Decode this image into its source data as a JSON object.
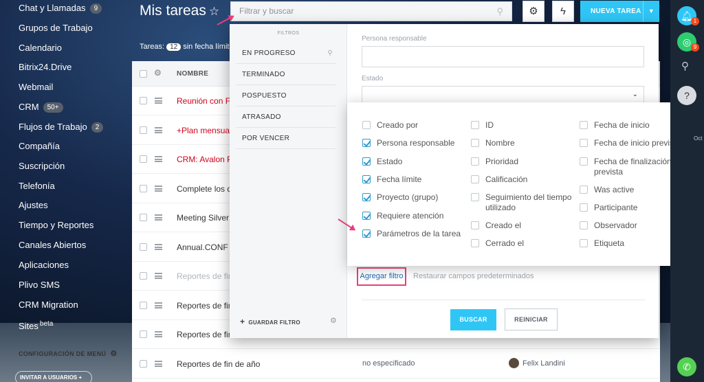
{
  "sidebar": {
    "items": [
      {
        "label": "Chat y Llamadas",
        "badge": "9"
      },
      {
        "label": "Grupos de Trabajo"
      },
      {
        "label": "Calendario"
      },
      {
        "label": "Bitrix24.Drive"
      },
      {
        "label": "Webmail"
      },
      {
        "label": "CRM",
        "badge": "50+"
      },
      {
        "label": "Flujos de Trabajo",
        "badge": "2"
      },
      {
        "label": "Compañía"
      },
      {
        "label": "Suscripción"
      },
      {
        "label": "Telefonía"
      },
      {
        "label": "Ajustes"
      },
      {
        "label": "Tiempo y Reportes"
      },
      {
        "label": "Canales Abiertos"
      },
      {
        "label": "Aplicaciones"
      },
      {
        "label": "Plivo SMS"
      },
      {
        "label": "CRM Migration"
      },
      {
        "label": "Sites",
        "sup": "beta"
      }
    ],
    "config_label": "CONFIGURACIÓN DE MENÚ",
    "invite_label": "INVITAR A USUARIOS"
  },
  "header": {
    "title": "Mis tareas",
    "search_placeholder": "Filtrar y buscar",
    "new_task_label": "NUEVA TAREA",
    "tasks_label": "Tareas:",
    "tasks_count": "12",
    "tasks_suffix": "sin fecha límit"
  },
  "table": {
    "column_name": "NOMBRE",
    "rows": [
      {
        "name": "Reunión con Fe",
        "color": "#d0021b"
      },
      {
        "name": "+Plan mensual",
        "color": "#d0021b"
      },
      {
        "name": "CRM: Avalon P",
        "color": "#d0021b"
      },
      {
        "name": "Complete los d",
        "color": "#333333"
      },
      {
        "name": "Meeting Silver F",
        "color": "#333333"
      },
      {
        "name": "Annual.CONF",
        "color": "#333333"
      },
      {
        "name": "Reportes de fin",
        "color": "#b0b6bc"
      },
      {
        "name": "Reportes de fin",
        "color": "#333333"
      },
      {
        "name": "Reportes de fin",
        "color": "#333333"
      },
      {
        "name": "Reportes de fin de año",
        "color": "#333333",
        "deadline": "no especificado",
        "responsible": "Felix Landini"
      }
    ]
  },
  "filter": {
    "presets_title": "FILTROS",
    "presets": [
      "EN PROGRESO",
      "TERMINADO",
      "POSPUESTO",
      "ATRASADO",
      "POR VENCER"
    ],
    "save_label": "GUARDAR FILTRO",
    "field_responsible_label": "Persona responsable",
    "field_status_label": "Estado",
    "add_filter_label": "Agregar filtro",
    "restore_label": "Restaurar campos predeterminados",
    "search_button": "BUSCAR",
    "reset_button": "REINICIAR"
  },
  "picker": {
    "col1": [
      {
        "label": "Creado por",
        "checked": false
      },
      {
        "label": "Persona responsable",
        "checked": true
      },
      {
        "label": "Estado",
        "checked": true
      },
      {
        "label": "Fecha límite",
        "checked": true
      },
      {
        "label": "Proyecto (grupo)",
        "checked": true
      },
      {
        "label": "Requiere atención",
        "checked": true
      },
      {
        "label": "Parámetros de la tarea",
        "checked": true
      }
    ],
    "col2": [
      {
        "label": "ID",
        "checked": false
      },
      {
        "label": "Nombre",
        "checked": false
      },
      {
        "label": "Prioridad",
        "checked": false
      },
      {
        "label": "Calificación",
        "checked": false
      },
      {
        "label": "Seguimiento del tiempo utilizado",
        "checked": false
      },
      {
        "label": "Creado el",
        "checked": false
      },
      {
        "label": "Cerrado el",
        "checked": false
      }
    ],
    "col3": [
      {
        "label": "Fecha de inicio",
        "checked": false
      },
      {
        "label": "Fecha de inicio prevista",
        "checked": false
      },
      {
        "label": "Fecha de finalización prevista",
        "checked": false
      },
      {
        "label": "Was active",
        "checked": false
      },
      {
        "label": "Participante",
        "checked": false
      },
      {
        "label": "Observador",
        "checked": false
      },
      {
        "label": "Etiqueta",
        "checked": false
      }
    ]
  },
  "rightbar": {
    "notifications_badge": "1",
    "apps_badge": "9",
    "calendar_text": "Oct"
  },
  "colors": {
    "accent": "#2fc6f6",
    "annotation": "#e4407d",
    "link": "#2067b0",
    "overdue": "#d0021b"
  }
}
